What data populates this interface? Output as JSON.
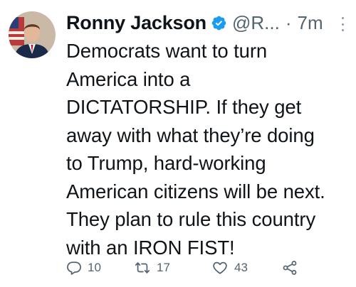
{
  "tweet": {
    "author": {
      "display_name": "Ronny Jackson",
      "handle": "@R...",
      "verified": true,
      "avatar": "profile-photo"
    },
    "separator": "·",
    "time": "7m",
    "text": "Democrats want to turn\nAmerica into a\nDICTATORSHIP. If they get\naway with what they’re doing\nto Trump, hard-working\nAmerican citizens will be next.\nThey plan to rule this country\nwith an IRON FIST!",
    "actions": {
      "reply": {
        "icon": "reply-icon",
        "count": "10"
      },
      "retweet": {
        "icon": "retweet-icon",
        "count": "17"
      },
      "like": {
        "icon": "heart-icon",
        "count": "43"
      },
      "share": {
        "icon": "share-icon"
      }
    }
  },
  "colors": {
    "text": "#0f1419",
    "secondary": "#536471",
    "verified": "#1d9bf0"
  }
}
